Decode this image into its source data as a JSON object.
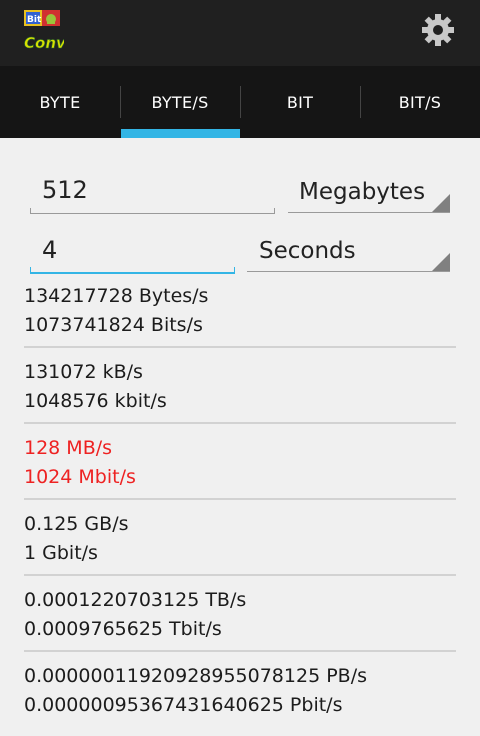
{
  "app": {
    "logo_icon": "bit-converter-logo-icon",
    "settings_icon": "gear-icon"
  },
  "tabs": [
    {
      "label": "BYTE"
    },
    {
      "label": "BYTE/S"
    },
    {
      "label": "BIT"
    },
    {
      "label": "BIT/S"
    }
  ],
  "active_tab": "BYTE/S",
  "accent_color": "#33b5e5",
  "highlight_color": "#ee2222",
  "size_input": {
    "value": "512"
  },
  "size_unit": {
    "selected": "Megabytes"
  },
  "time_input": {
    "value": "4"
  },
  "time_unit": {
    "selected": "Seconds"
  },
  "results": [
    {
      "line1": "134217728 Bytes/s",
      "line2": "1073741824 Bits/s",
      "highlight": false
    },
    {
      "line1": "131072 kB/s",
      "line2": "1048576 kbit/s",
      "highlight": false
    },
    {
      "line1": "128 MB/s",
      "line2": "1024 Mbit/s",
      "highlight": true
    },
    {
      "line1": "0.125 GB/s",
      "line2": "1 Gbit/s",
      "highlight": false
    },
    {
      "line1": "0.0001220703125 TB/s",
      "line2": "0.0009765625 Tbit/s",
      "highlight": false
    },
    {
      "line1": "0.00000011920928955078125 PB/s",
      "line2": "0.00000095367431640625 Pbit/s",
      "highlight": false
    }
  ]
}
